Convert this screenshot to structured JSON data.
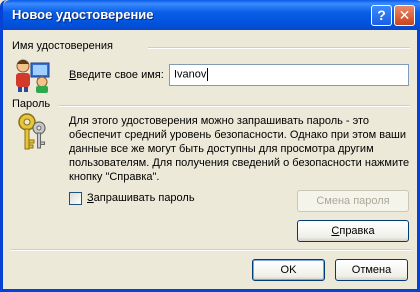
{
  "window": {
    "title": "Новое удостоверение"
  },
  "titlebar_buttons": {
    "help": "?",
    "close": "✕"
  },
  "identity": {
    "section_title": "Имя удостоверения",
    "name_label_prefix": "",
    "name_label_accel": "В",
    "name_label_rest": "ведите свое имя:",
    "name_value": "Ivanov"
  },
  "password": {
    "section_title": "Пароль",
    "description": "Для этого удостоверения можно запрашивать пароль - это обеспечит средний уровень безопасности. Однако при этом ваши данные все же могут быть доступны для просмотра другим пользователям. Для получения сведений о безопасности нажмите кнопку \"Справка\".",
    "ask_accel": "З",
    "ask_rest": "апрашивать пароль",
    "ask_checked": false,
    "change_button": "Смена пароля",
    "help_accel": "С",
    "help_rest": "правка"
  },
  "footer": {
    "ok": "OK",
    "cancel": "Отмена"
  },
  "colors": {
    "titlebar": "#0052dd",
    "dialog_bg": "#ece9d8",
    "input_border": "#7f9db9"
  },
  "icons": {
    "identity": "people-at-computer-icon",
    "password": "keys-icon"
  }
}
